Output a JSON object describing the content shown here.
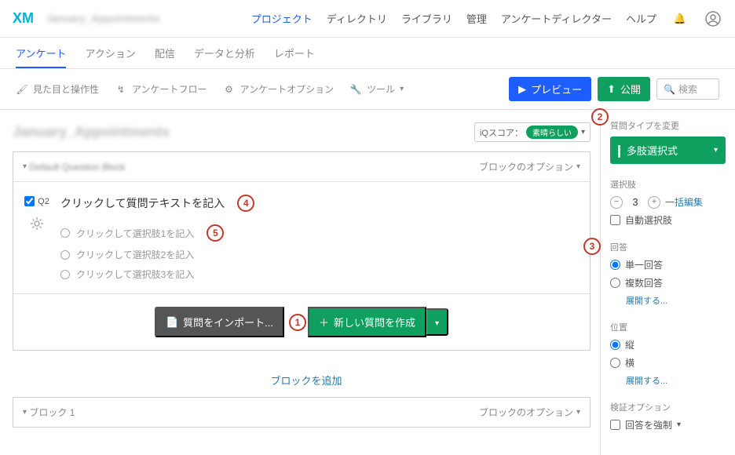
{
  "header": {
    "logo": "XM",
    "project_name": "January_Appointments",
    "nav": {
      "projects": "プロジェクト",
      "directory": "ディレクトリ",
      "library": "ライブラリ",
      "admin": "管理",
      "director": "アンケートディレクター",
      "help": "ヘルプ"
    }
  },
  "subnav": {
    "survey": "アンケート",
    "actions": "アクション",
    "distribute": "配信",
    "data": "データと分析",
    "reports": "レポート"
  },
  "toolbar": {
    "look": "見た目と操作性",
    "flow": "アンケートフロー",
    "options": "アンケートオプション",
    "tools": "ツール",
    "preview": "プレビュー",
    "publish": "公開",
    "search_ph": "検索"
  },
  "survey": {
    "title": "January_Appointments",
    "iq_label": "iQスコア：",
    "iq_score": "素晴らしい",
    "block_name": "Default Question Block",
    "block_options": "ブロックのオプション",
    "q_id": "Q2",
    "q_text": "クリックして質問テキストを記入",
    "choices": [
      "クリックして選択肢1を記入",
      "クリックして選択肢2を記入",
      "クリックして選択肢3を記入"
    ],
    "import_q": "質問をインポート...",
    "new_q": "新しい質問を作成",
    "add_block": "ブロックを追加",
    "block2_name": "ブロック 1"
  },
  "sidebar": {
    "change_type": "質問タイプを変更",
    "qtype": "多肢選択式",
    "choices_label": "選択肢",
    "choice_count": "3",
    "bulk_edit": "一括編集",
    "auto_choice": "自動選択肢",
    "answers_label": "回答",
    "single": "単一回答",
    "multiple": "複数回答",
    "expand": "展開する...",
    "position_label": "位置",
    "vertical": "縦",
    "horizontal": "横",
    "validation_label": "検証オプション",
    "force": "回答を強制"
  },
  "annotations": {
    "a1": "1",
    "a2": "2",
    "a3": "3",
    "a4": "4",
    "a5": "5"
  }
}
